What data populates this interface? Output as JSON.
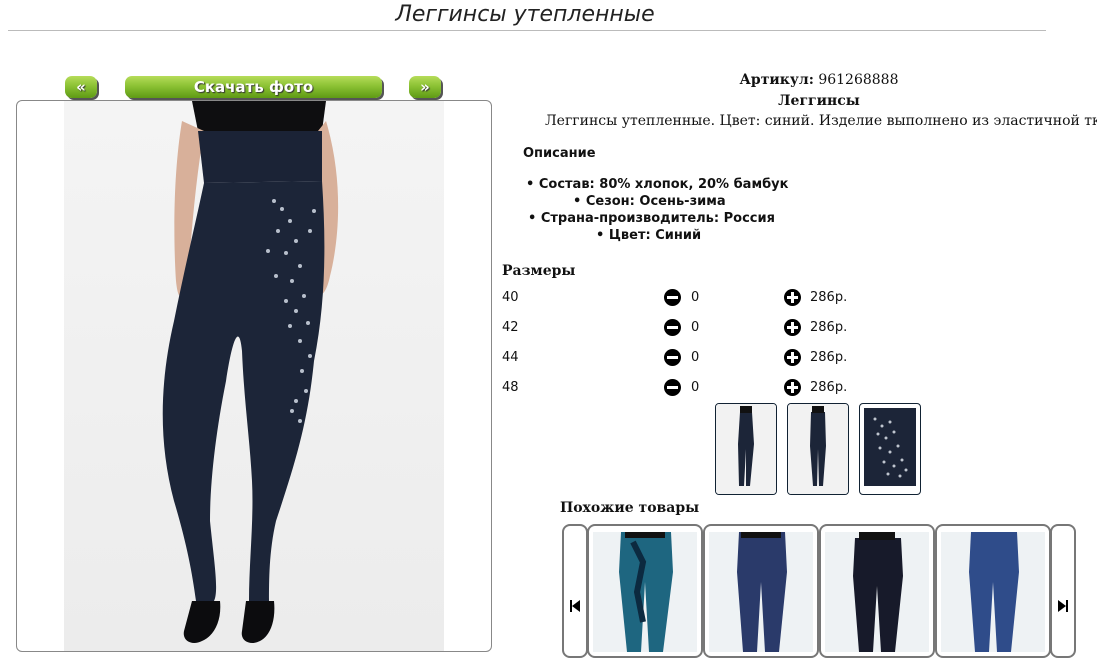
{
  "page_title": "Леггинсы утепленные",
  "photo_nav": {
    "prev_label": "«",
    "download_label": "Скачать фото",
    "next_label": "»"
  },
  "product": {
    "article_label": "Артикул:",
    "article_value": "961268888",
    "name": "Леггинсы",
    "short_description": "Леггинсы утепленные. Цвет: синий. Изделие выполнено из эластичной ткани",
    "description_heading": "Описание",
    "features": [
      "Состав: 80% хлопок, 20% бамбук",
      "Сезон: Осень-зима",
      "Страна-производитель: Россия",
      "Цвет: Синий"
    ]
  },
  "sizes": {
    "heading": "Размеры",
    "rows": [
      {
        "size": "40",
        "qty": "0",
        "price": "286р."
      },
      {
        "size": "42",
        "qty": "0",
        "price": "286р."
      },
      {
        "size": "44",
        "qty": "0",
        "price": "286р."
      },
      {
        "size": "48",
        "qty": "0",
        "price": "286р."
      }
    ]
  },
  "similar": {
    "heading": "Похожие товары"
  },
  "colors": {
    "accent_green": "#8cc234",
    "legging_navy": "#1c2538",
    "border": "#777777"
  }
}
